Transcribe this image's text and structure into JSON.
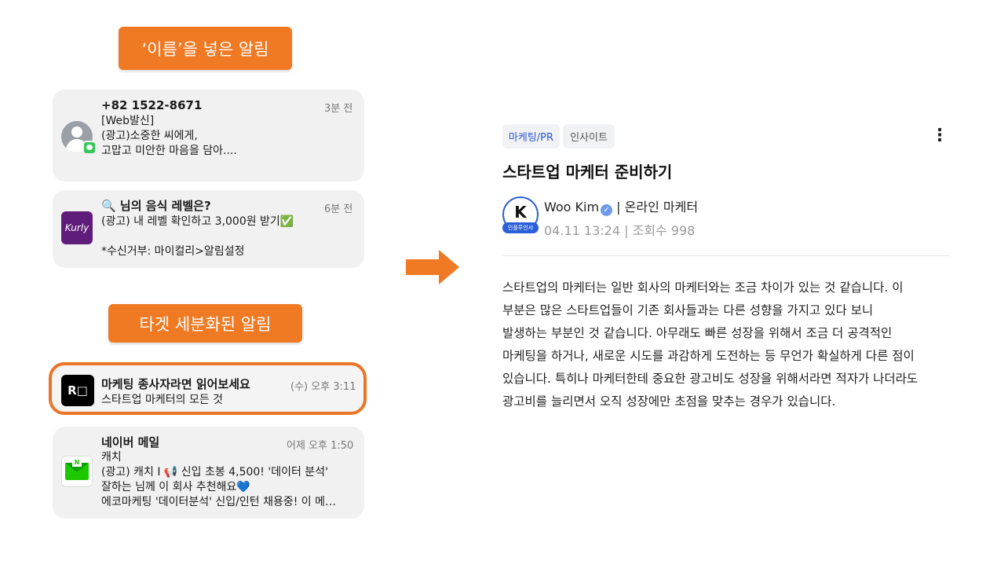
{
  "left": {
    "section1_label": "‘이름’을 넣은 알림",
    "section2_label": "타겟 세분화된 알림",
    "notifications": [
      {
        "sender": "+82 1522-8671",
        "time": "3분 전",
        "lines": [
          "[Web발신]",
          "(광고)소중한        씨에게,",
          "고맙고 미안한 마음을 담아...."
        ],
        "icon": "person-avatar-icon"
      },
      {
        "sender": "🔍        님의 음식 레벨은?",
        "time": "6분 전",
        "lines": [
          "(광고) 내 레벨 확인하고 3,000원 받기✅",
          "",
          "*수신거부: 마이컬리>알림설정"
        ],
        "icon": "kurly-app-icon",
        "icon_text": "Kurly"
      },
      {
        "sender": "마케팅 종사자라면 읽어보세요",
        "time": "(수) 오후 3:11",
        "lines": [
          "스타트업 마케터의 모든 것"
        ],
        "icon": "rocketpunch-app-icon",
        "icon_text": "R□"
      },
      {
        "sender": "네이버 메일",
        "time": "어제 오후 1:50",
        "lines": [
          "캐치",
          "(광고) 캐치 I 📢 신입 초봉 4,500! '데이터 분석'",
          "잘하는         님께 이 회사 추천해요💙",
          "에코마케팅 '데이터분석' 신입/인턴 채용중! 이 메…"
        ],
        "icon": "naver-mail-icon",
        "icon_text": "N"
      }
    ]
  },
  "article": {
    "tags": [
      "마케팅/PR",
      "인사이트"
    ],
    "title": "스타트업 마케터 준비하기",
    "avatar_letter": "K",
    "avatar_badge": "인플루언서",
    "author_name": "Woo Kim",
    "author_role": " | 온라인 마케터",
    "date": "04.11 13:24",
    "views": " | 조회수 998",
    "body_lines": [
      "스타트업의 마케터는 일반 회사의 마케터와는 조금 차이가 있는 것 같습니다. 이",
      "부분은 많은 스타트업들이 기존 회사들과는 다른 성향을 가지고 있다 보니",
      "발생하는 부분인 것 같습니다. 아무래도 빠른 성장을 위해서 조금 더 공격적인",
      "마케팅을 하거나, 새로운 시도를 과감하게 도전하는 등 무언가 확실하게 다른 점이",
      "있습니다. 특히나 마케터한테 중요한 광고비도 성장을 위해서라면 적자가 나더라도",
      "광고비를 늘리면서 오직 성장에만 초점을 맞추는 경우가 있습니다."
    ]
  },
  "colors": {
    "accent_orange": "#f07a24",
    "tag_blue": "#2a57d1"
  }
}
